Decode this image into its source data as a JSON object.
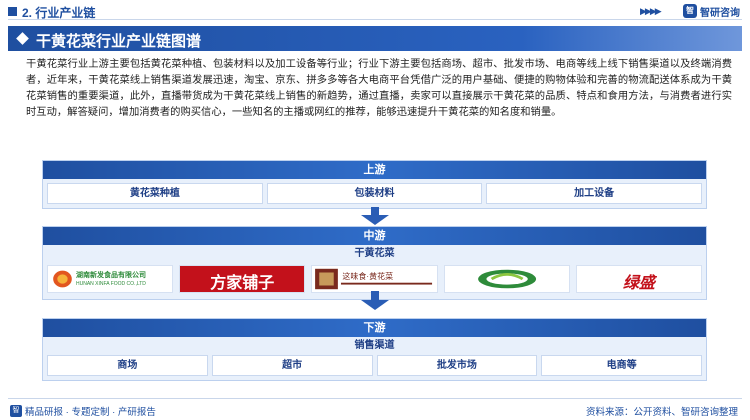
{
  "header": {
    "section_title": "2. 行业产业链",
    "brand_name": "智研咨询",
    "brand_logo_text": "智"
  },
  "banner": {
    "title": "干黄花菜行业产业链图谱"
  },
  "description": "干黄花菜行业上游主要包括黄花菜种植、包装材料以及加工设备等行业；行业下游主要包括商场、超市、批发市场、电商等线上线下销售渠道以及终端消费者，近年来，干黄花菜线上销售渠道发展迅速，淘宝、京东、拼多多等各大电商平台凭借广泛的用户基础、便捷的购物体验和完善的物流配送体系成为干黄花菜销售的重要渠道，此外，直播带货成为干黄花菜线上销售的新趋势，通过直播，卖家可以直接展示干黄花菜的品质、特点和食用方法，与消费者进行实时互动，解答疑问，增加消费者的购买信心，一些知名的主播或网红的推荐，能够迅速提升干黄花菜的知名度和销量。",
  "upstream": {
    "label": "上游",
    "items": [
      "黄花菜种植",
      "包装材料",
      "加工设备"
    ]
  },
  "midstream": {
    "label": "中游",
    "sublabel": "干黄花菜",
    "logos": [
      {
        "text": "湖南新发食品有限公司",
        "en": "HUNAN XINFA FOOD CO.,LTD"
      },
      {
        "text": "方家铺子"
      },
      {
        "text": "这味食·黄花菜"
      },
      {
        "text": ""
      },
      {
        "text": "绿盛"
      }
    ]
  },
  "downstream": {
    "label": "下游",
    "sublabel": "销售渠道",
    "items": [
      "商场",
      "超市",
      "批发市场",
      "电商等"
    ]
  },
  "footer": {
    "left_text": "精品研报 · 专题定制 · 产研报告",
    "right_text": "资料来源：公开资料、智研咨询整理"
  },
  "colors": {
    "primary": "#1f4fa0",
    "tier_bg": "#e8f0fb"
  }
}
